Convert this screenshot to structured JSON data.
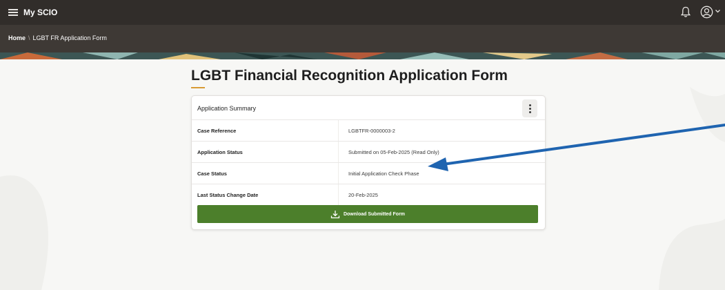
{
  "header": {
    "app_title": "My SCIO",
    "icons": [
      "hamburger-icon",
      "bell-icon",
      "user-icon",
      "chevron-down-icon"
    ]
  },
  "breadcrumb": {
    "home": "Home",
    "separator": "\\",
    "current": "LGBT FR Application Form"
  },
  "page": {
    "title": "LGBT Financial Recognition Application Form"
  },
  "summary": {
    "header": "Application Summary",
    "rows": [
      {
        "label": "Case Reference",
        "value": "LGBTFR-0000003-2"
      },
      {
        "label": "Application Status",
        "value": "Submitted on 05-Feb-2025 (Read Only)"
      },
      {
        "label": "Case Status",
        "value": "Initial Application Check Phase"
      },
      {
        "label": "Last Status Change Date",
        "value": "20-Feb-2025"
      }
    ],
    "download_button": "Download Submitted Form"
  },
  "colors": {
    "topbar": "#312d2a",
    "breadcrumb_bar": "#3e3935",
    "accent_underline": "#d89b34",
    "button_green": "#4c7f2b",
    "annotation_arrow": "#1f64b0"
  }
}
